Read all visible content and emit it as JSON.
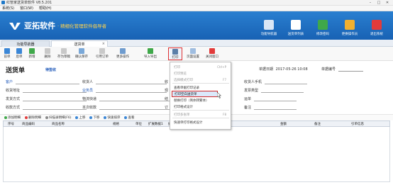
{
  "window": {
    "title": "红管家送货单软件 V8.5.201"
  },
  "menubar": {
    "items": [
      "系统(S)",
      "窗口(W)",
      "帮助(H)"
    ]
  },
  "banner": {
    "brand": "亚拓软件",
    "slogan": "· 精细化管理软件倡导者",
    "nav": [
      {
        "label": "功能导航器",
        "icon": "monitor-icon",
        "color": "#d9e6f5"
      },
      {
        "label": "送货单列表",
        "icon": "list-icon",
        "color": "#ffffff"
      },
      {
        "label": "修改密码",
        "icon": "key-icon",
        "color": "#3fa84a"
      },
      {
        "label": "更换操作员",
        "icon": "user-switch-icon",
        "color": "#f0b030"
      },
      {
        "label": "退出系统",
        "icon": "power-icon",
        "color": "#e23b3b"
      }
    ]
  },
  "tabs": [
    {
      "label": "功能导航器"
    },
    {
      "label": "送货单"
    }
  ],
  "toolbar": [
    {
      "label": "前单",
      "icon": "prev-arrow-icon",
      "color": "#3a86d6"
    },
    {
      "label": "后单",
      "icon": "next-arrow-icon",
      "color": "#3a86d6"
    },
    {
      "label": "新增",
      "icon": "add-icon",
      "color": "#3fa84a"
    },
    {
      "label": "删除",
      "icon": "delete-icon",
      "color": "#c9c9c9"
    },
    {
      "label": "存为草稿",
      "icon": "draft-icon",
      "color": "#c9c9c9"
    },
    {
      "label": "确认保存",
      "icon": "save-icon",
      "color": "#7aa8d8"
    },
    {
      "label": "引用订单",
      "icon": "reference-icon",
      "color": "#c9c9c9"
    },
    {
      "label": "更多操作",
      "icon": "more-icon",
      "color": "#6f9ccf"
    },
    {
      "label": "导入导出",
      "icon": "import-export-icon",
      "color": "#3fa84a"
    },
    {
      "label": "打印",
      "icon": "printer-icon",
      "color": "#5a7ea8"
    },
    {
      "label": "页面设置",
      "icon": "page-setup-icon",
      "color": "#9fbde0"
    },
    {
      "label": "关闭窗口",
      "icon": "close-window-icon",
      "color": "#e23b3b"
    }
  ],
  "form": {
    "title": "送货单",
    "status": "待签收",
    "date_label": "单据日期",
    "date_value": "2017-05-26 10:08",
    "billno_label": "单据编号",
    "fields": [
      {
        "label": "客户",
        "blue": true
      },
      {
        "label": "收货人",
        "blue": false
      },
      {
        "label": "收货人手机",
        "blue": false
      },
      {
        "label": "收货地址",
        "blue": false
      },
      {
        "label": "业务员",
        "blue": true
      },
      {
        "label": "发票类型",
        "blue": false
      },
      {
        "label": "发货方式",
        "blue": false
      },
      {
        "label": "物流快递",
        "blue": false
      },
      {
        "label": "运单",
        "blue": false
      },
      {
        "label": "收款方式",
        "blue": false
      },
      {
        "label": "本次收款",
        "blue": false
      },
      {
        "label": "备注",
        "blue": false
      }
    ],
    "partial_labels": [
      "收",
      "现",
      "结",
      "订"
    ]
  },
  "detail_toolbar": [
    {
      "label": "添加明细",
      "color": "#3fa84a"
    },
    {
      "label": "删除明细",
      "color": "#e23b3b"
    },
    {
      "label": "扫描录明细(F6)",
      "color": "#888888"
    },
    {
      "label": "上移",
      "color": "#3a86d6"
    },
    {
      "label": "下移",
      "color": "#3a86d6"
    },
    {
      "label": "快速排序",
      "color": "#3a86d6"
    },
    {
      "label": "查看",
      "color": "#3a86d6"
    }
  ],
  "table": {
    "columns": [
      "序号",
      "商品编码",
      "商品名称",
      "规格",
      "单位",
      "扩展数据1",
      "扩展数",
      "金额",
      "备注",
      "引单信息"
    ]
  },
  "print_menu": {
    "items": [
      {
        "label": "打印",
        "shortcut": "Ctrl+P",
        "disabled": true
      },
      {
        "label": "打印预览",
        "shortcut": "",
        "disabled": true
      },
      {
        "label": "选择模式打印",
        "shortcut": "F7",
        "disabled": true
      },
      {
        "label": "查看单据打印记录",
        "shortcut": "",
        "disabled": false
      },
      {
        "label": "打印空白送货单",
        "shortcut": "",
        "disabled": false,
        "highlighted": true
      },
      {
        "label": "替换打印（简体转繁体）",
        "shortcut": "",
        "disabled": false
      },
      {
        "label": "打印格式设计",
        "shortcut": "",
        "disabled": false
      },
      {
        "label": "打印多张单",
        "shortcut": "F8",
        "disabled": true
      },
      {
        "label": "快速单打印格式设计",
        "shortcut": "",
        "disabled": false
      }
    ]
  }
}
